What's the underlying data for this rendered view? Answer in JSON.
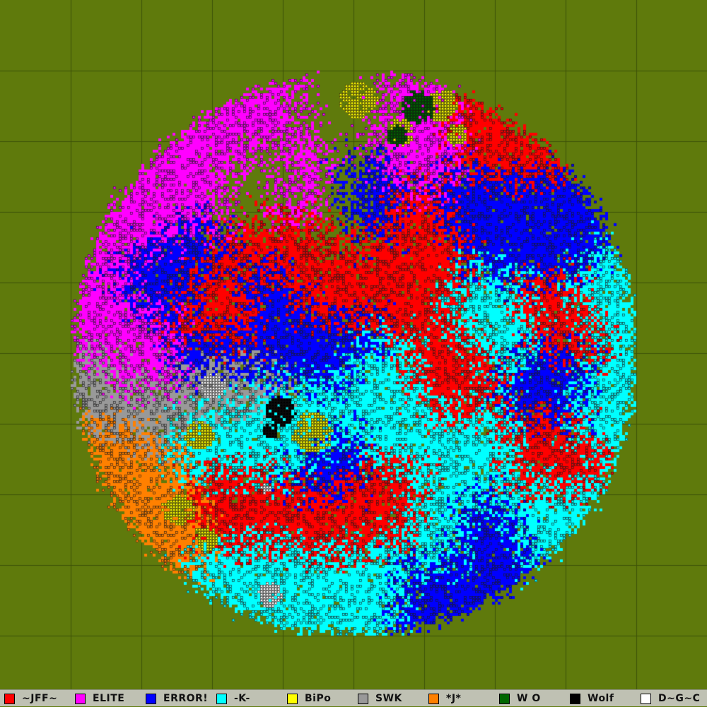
{
  "map": {
    "background_color": "#5f7a0c",
    "grid_color": "#3d5208",
    "grid_divisions": 10,
    "cell_outline_color": "#1a1a1a"
  },
  "legend": [
    {
      "name": "~JFF~",
      "color": "#ff0000"
    },
    {
      "name": "ELITE",
      "color": "#ff00ff"
    },
    {
      "name": "ERROR!",
      "color": "#0000ff"
    },
    {
      "name": "-K-",
      "color": "#00ffff"
    },
    {
      "name": "BiPo",
      "color": "#ffff00"
    },
    {
      "name": "SWK",
      "color": "#999999"
    },
    {
      "name": "*J*",
      "color": "#ff8000"
    },
    {
      "name": "W O",
      "color": "#006600"
    },
    {
      "name": "Wolf",
      "color": "#000000"
    },
    {
      "name": "D~G~C",
      "color": "#ffffff"
    }
  ]
}
